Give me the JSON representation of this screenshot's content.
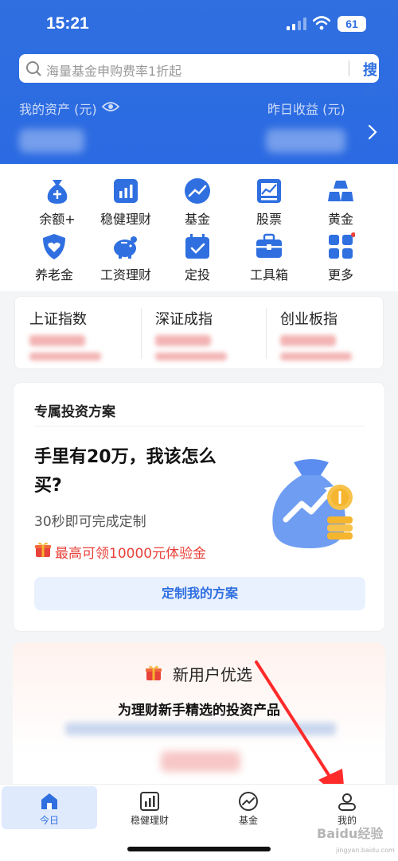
{
  "status": {
    "time": "15:21",
    "battery": "61"
  },
  "search": {
    "placeholder": "海量基金申购费率1折起",
    "button": "搜索"
  },
  "assets": {
    "label": "我的资产 (元)",
    "yesterday_label": "昨日收益 (元)"
  },
  "menu": [
    {
      "label": "余额+",
      "icon": "money-bag-icon"
    },
    {
      "label": "稳健理财",
      "icon": "bar-chart-icon"
    },
    {
      "label": "基金",
      "icon": "trend-icon"
    },
    {
      "label": "股票",
      "icon": "stock-icon"
    },
    {
      "label": "黄金",
      "icon": "gold-icon"
    },
    {
      "label": "养老金",
      "icon": "shield-heart-icon"
    },
    {
      "label": "工资理财",
      "icon": "piggy-bank-icon"
    },
    {
      "label": "定投",
      "icon": "calendar-check-icon"
    },
    {
      "label": "工具箱",
      "icon": "toolbox-icon"
    },
    {
      "label": "更多",
      "icon": "grid-icon"
    }
  ],
  "indices": [
    {
      "name": "上证指数"
    },
    {
      "name": "深证成指"
    },
    {
      "name": "创业板指"
    }
  ],
  "plan": {
    "title": "专属投资方案",
    "headline": "手里有20万，我该怎么买?",
    "sub": "30秒即可完成定制",
    "bonus": "最高可领10000元体验金",
    "button": "定制我的方案"
  },
  "new_user": {
    "title": "新用户优选",
    "subtitle": "为理财新手精选的投资产品"
  },
  "tabs": [
    {
      "label": "今日",
      "icon": "home-icon",
      "active": true
    },
    {
      "label": "稳健理财",
      "icon": "bar-chart-icon"
    },
    {
      "label": "基金",
      "icon": "trend-icon"
    },
    {
      "label": "我的",
      "icon": "user-icon"
    }
  ],
  "watermark": {
    "text": "Baidu经验",
    "url": "jingyan.baidu.com"
  },
  "colors": {
    "primary": "#2f6fe0",
    "accent_red": "#e8423b",
    "gold": "#f5b52e"
  }
}
